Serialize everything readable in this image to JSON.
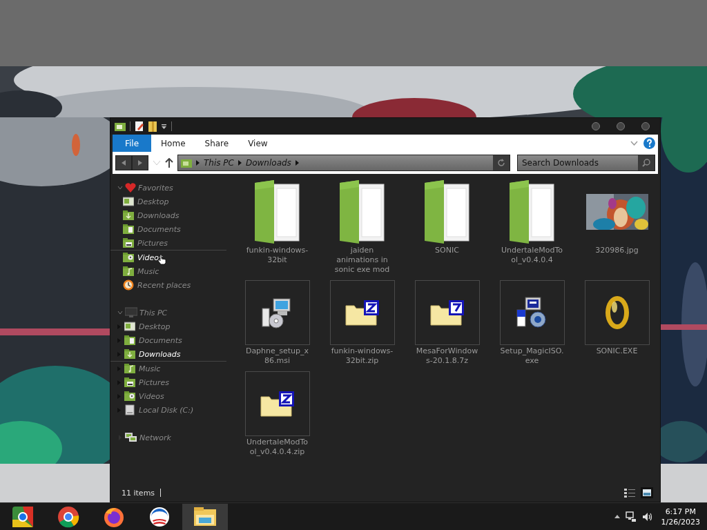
{
  "window": {
    "status": "11 items"
  },
  "ribbon": {
    "tabs": [
      {
        "label": "File",
        "selected": true
      },
      {
        "label": "Home",
        "selected": false
      },
      {
        "label": "Share",
        "selected": false
      },
      {
        "label": "View",
        "selected": false
      }
    ]
  },
  "address_bar": {
    "crumbs": [
      "This PC",
      "Downloads"
    ],
    "search_placeholder": "Search Downloads"
  },
  "sidebar": {
    "groups": [
      {
        "label": "Favorites",
        "kind": "favorites",
        "expanded": true,
        "children": [
          {
            "label": "Desktop",
            "kind": "desktop",
            "selected": false,
            "hovered": false
          },
          {
            "label": "Downloads",
            "kind": "downloads",
            "selected": false,
            "hovered": false
          },
          {
            "label": "Documents",
            "kind": "documents",
            "selected": false,
            "hovered": false
          },
          {
            "label": "Pictures",
            "kind": "pictures",
            "selected": false,
            "hovered": false
          },
          {
            "label": "Videos",
            "kind": "videos",
            "selected": false,
            "hovered": true
          },
          {
            "label": "Music",
            "kind": "music",
            "selected": false,
            "hovered": false
          },
          {
            "label": "Recent places",
            "kind": "recent",
            "selected": false,
            "hovered": false
          }
        ]
      },
      {
        "label": "This PC",
        "kind": "pc",
        "expanded": true,
        "children": [
          {
            "label": "Desktop",
            "kind": "desktop",
            "selected": false,
            "hovered": false
          },
          {
            "label": "Documents",
            "kind": "documents",
            "selected": false,
            "hovered": false
          },
          {
            "label": "Downloads",
            "kind": "downloads",
            "selected": true,
            "hovered": false
          },
          {
            "label": "Music",
            "kind": "music",
            "selected": false,
            "hovered": false
          },
          {
            "label": "Pictures",
            "kind": "pictures",
            "selected": false,
            "hovered": false
          },
          {
            "label": "Videos",
            "kind": "videos",
            "selected": false,
            "hovered": false
          },
          {
            "label": "Local Disk (C:)",
            "kind": "disk",
            "selected": false,
            "hovered": false
          }
        ]
      },
      {
        "label": "Network",
        "kind": "network",
        "expanded": false
      }
    ]
  },
  "files": [
    {
      "name": "funkin-windows-\n32bit",
      "kind": "folder"
    },
    {
      "name": "jaiden\nanimations in\nsonic exe mod",
      "kind": "folder"
    },
    {
      "name": "SONIC",
      "kind": "folder"
    },
    {
      "name": "UndertaleModTo\nol_v0.4.0.4",
      "kind": "folder"
    },
    {
      "name": "320986.jpg",
      "kind": "picture"
    },
    {
      "name": "Daphne_setup_x\n86.msi",
      "kind": "installer"
    },
    {
      "name": "funkin-windows-\n32bit.zip",
      "kind": "zip"
    },
    {
      "name": "MesaForWindow\ns-20.1.8.7z",
      "kind": "sevenzip"
    },
    {
      "name": "Setup_MagicISO.\nexe",
      "kind": "setup"
    },
    {
      "name": "SONIC.EXE",
      "kind": "ring"
    },
    {
      "name": "UndertaleModTo\nol_v0.4.0.4.zip",
      "kind": "zip"
    }
  ],
  "taskbar": {
    "apps": [
      {
        "kind": "chromium",
        "active": false
      },
      {
        "kind": "chrome",
        "active": false
      },
      {
        "kind": "firefox",
        "active": false
      },
      {
        "kind": "logo",
        "active": false
      },
      {
        "kind": "explorer",
        "active": true
      }
    ],
    "time": "6:17 PM",
    "date": "1/26/2023"
  }
}
